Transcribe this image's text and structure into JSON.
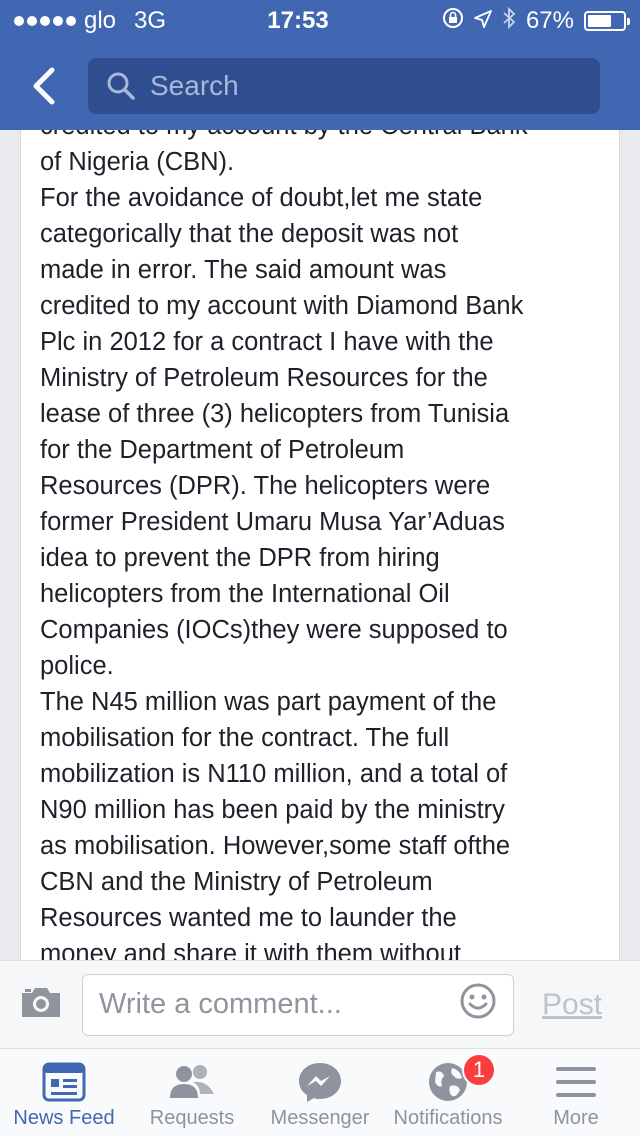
{
  "status_bar": {
    "carrier": "glo",
    "network": "3G",
    "time": "17:53",
    "battery_percent": "67%",
    "battery_level": 0.67
  },
  "nav": {
    "back_icon": "chevron-left-icon",
    "search_placeholder": "Search"
  },
  "post": {
    "lines": [
      "credited to my account by the Central Bank",
      "of Nigeria (CBN).",
      "For the avoidance of doubt,let me state",
      "categorically that the deposit was not",
      "made in error. The said amount was",
      "credited to my account with Diamond Bank",
      "Plc in 2012 for a contract I have with the",
      "Ministry of Petroleum Resources for the",
      "lease of three (3) helicopters from Tunisia",
      "for the Department of Petroleum",
      "Resources (DPR). The helicopters were",
      "former President Umaru Musa Yar’Aduas",
      "idea to prevent the DPR from hiring",
      "helicopters from the International Oil",
      "Companies (IOCs)they were supposed to",
      "police.",
      "The N45 million was part payment of the",
      "mobilisation for the contract. The full",
      "mobilization is N110 million, and a total of",
      "N90 million has been paid by the ministry",
      "as mobilisation. However,some staff ofthe",
      "CBN and the Ministry of Petroleum",
      "Resources wanted me to launder the",
      "money and share it with them without"
    ]
  },
  "comment": {
    "placeholder": "Write a comment...",
    "post_label": "Post"
  },
  "tabs": [
    {
      "label": "News Feed",
      "icon": "news-feed-icon"
    },
    {
      "label": "Requests",
      "icon": "friend-requests-icon"
    },
    {
      "label": "Messenger",
      "icon": "messenger-icon"
    },
    {
      "label": "Notifications",
      "icon": "globe-icon",
      "badge": "1"
    },
    {
      "label": "More",
      "icon": "menu-icon"
    }
  ],
  "colors": {
    "brand": "#4267b2",
    "badge": "#fa3e3e"
  }
}
